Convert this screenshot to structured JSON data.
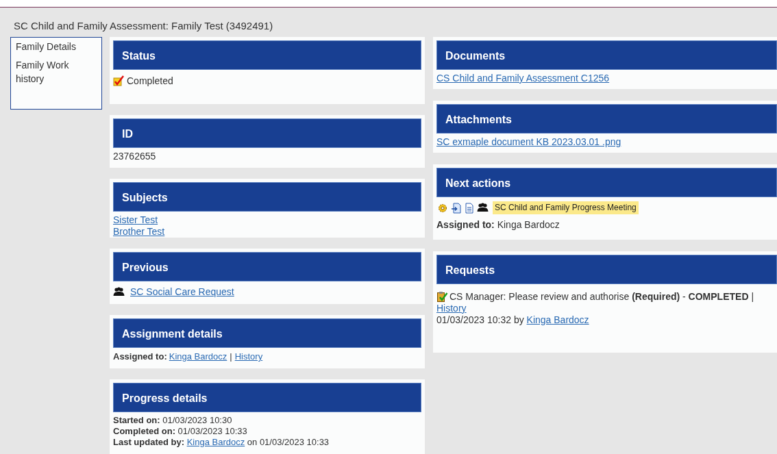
{
  "page_title": "SC Child and Family Assessment: Family Test (3492491)",
  "side_nav": [
    {
      "label": "Family Details"
    },
    {
      "label": "Family Work history"
    }
  ],
  "left_sections": [
    {
      "kind": "status",
      "title": "Status",
      "status": "Completed"
    },
    {
      "kind": "text",
      "title": "ID",
      "text": "23762655"
    },
    {
      "kind": "links",
      "title": "Subjects",
      "links": [
        "Sister Test",
        "Brother Test"
      ]
    },
    {
      "kind": "previous",
      "title": "Previous",
      "link": "SC Social Care Request "
    },
    {
      "kind": "assignment",
      "title": "Assignment details",
      "label": "Assigned to:",
      "assignee": "Kinga Bardocz",
      "separator": "|",
      "history": "History"
    },
    {
      "kind": "progress",
      "title": "Progress details",
      "lines": [
        {
          "text": "**Started on:** 01/03/2023 10:30"
        },
        {
          "text": "**Completed on:** 01/03/2023 10:33"
        },
        {
          "text": "**Last updated by:**",
          "link": "Kinga Bardocz",
          "suffix": "on 01/03/2023 10:33"
        }
      ]
    }
  ],
  "right_sections": [
    {
      "kind": "links",
      "title": "Documents",
      "links": [
        "CS Child and Family Assessment C1256"
      ]
    },
    {
      "kind": "links",
      "title": "Attachments",
      "links": [
        "SC exmaple document KB 2023.03.01 .png"
      ]
    },
    {
      "kind": "actions",
      "title": "Next actions",
      "action": "SC Child and Family Progress Meeting",
      "assigned": "**Assigned to:** Kinga Bardocz"
    },
    {
      "kind": "requests",
      "title": "Requests",
      "request": "CS Manager: Please review and authorise **(Required)** - **COMPLETED** |",
      "history": "History",
      "when": "01/03/2023 10:32 by",
      "by": "Kinga Bardocz"
    }
  ]
}
